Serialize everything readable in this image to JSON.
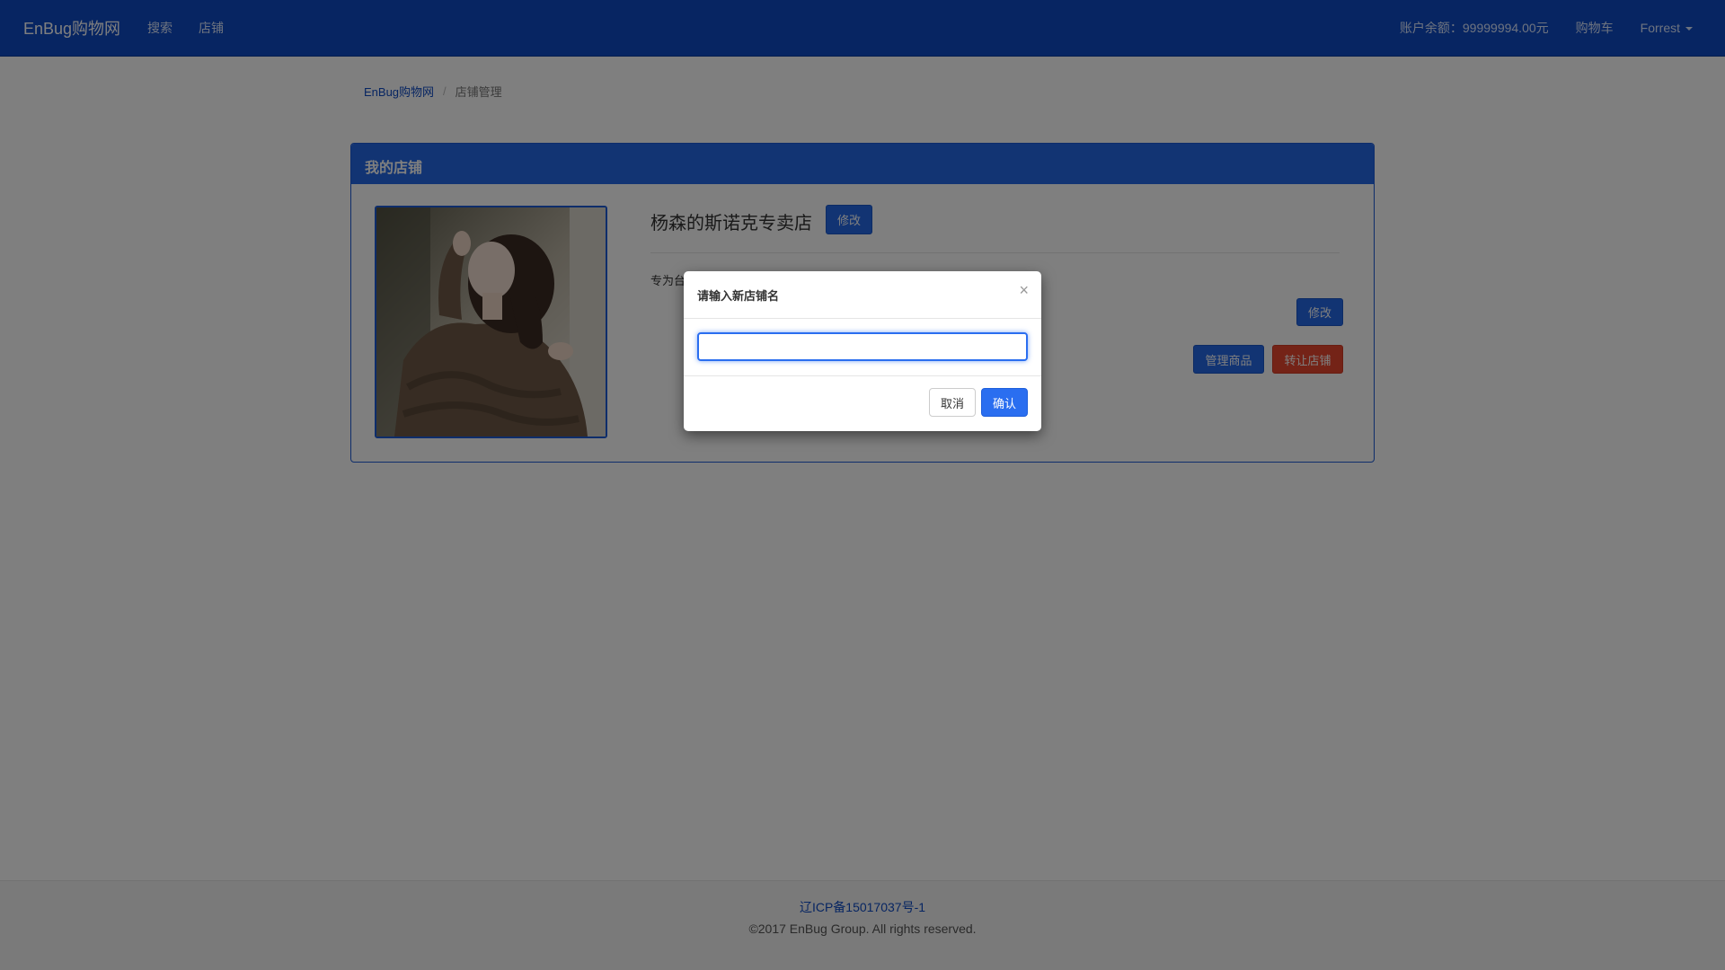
{
  "navbar": {
    "brand": "EnBug购物网",
    "links": [
      "搜索",
      "店铺"
    ],
    "balance": "账户余额：99999994.00元",
    "cart": "购物车",
    "user": "Forrest"
  },
  "breadcrumb": {
    "home": "EnBug购物网",
    "separator": "/",
    "current": "店铺管理"
  },
  "panel": {
    "heading": "我的店铺",
    "shop_name": "杨森的斯诺克专卖店",
    "edit_name_label": "修改",
    "description": "专为台",
    "edit_desc_label": "修改",
    "manage_products_label": "管理商品",
    "transfer_shop_label": "转让店铺"
  },
  "modal": {
    "title": "请输入新店铺名",
    "close": "×",
    "input_value": "",
    "cancel_label": "取消",
    "confirm_label": "确认"
  },
  "footer": {
    "icp": "辽ICP备15017037号-1",
    "copyright": "©2017 EnBug Group. All rights reserved."
  },
  "colors": {
    "primary": "#2468e6",
    "navbar": "#0e4ac4",
    "danger": "#e8462f"
  },
  "icons": {
    "close": "close-icon",
    "dropdown": "caret-down-icon"
  }
}
